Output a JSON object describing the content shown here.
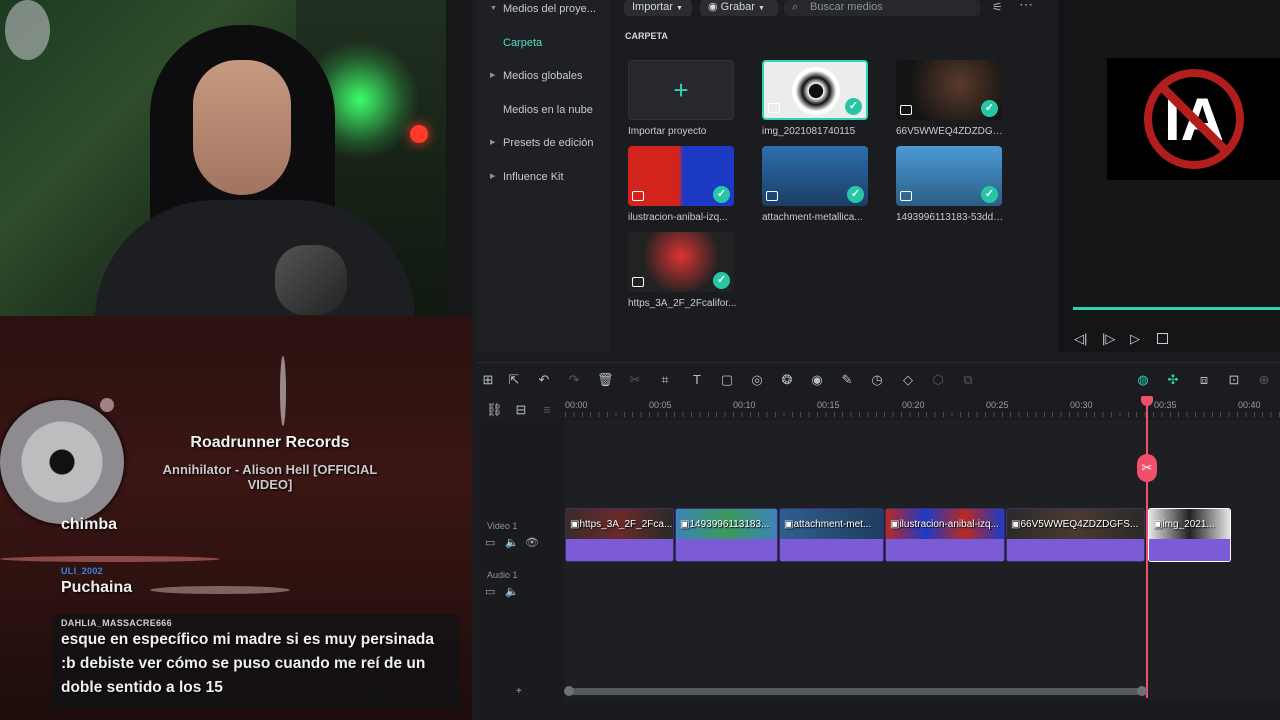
{
  "media_sidebar": {
    "items": [
      {
        "label": "Medios del proye...",
        "expand": true
      },
      {
        "label": "Carpeta",
        "active": true
      },
      {
        "label": "Medios globales",
        "expand": true
      },
      {
        "label": "Medios en la nube"
      },
      {
        "label": "Presets de edición",
        "expand": true
      },
      {
        "label": "Influence Kit",
        "expand": true
      }
    ]
  },
  "media_toolbar": {
    "import_label": "Importar",
    "record_label": "Grabar",
    "search_placeholder": "Buscar medios"
  },
  "media_grid": {
    "folder_label": "CARPETA",
    "import_card_label": "Importar proyecto",
    "items": [
      {
        "name": "img_2021081740115",
        "color": "#e8e8e8",
        "selected": true
      },
      {
        "name": "66V5WWEQ4ZDZDGFS...",
        "color": "#2b2a2a"
      },
      {
        "name": "ilustracion-anibal-izq...",
        "color": "#c8281e"
      },
      {
        "name": "attachment-metallica...",
        "color": "#3a6fa0"
      },
      {
        "name": "1493996113183-53dd4...",
        "color": "#3d84b8"
      },
      {
        "name": "https_3A_2F_2Fcalifor...",
        "color": "#2a2526"
      }
    ]
  },
  "now_playing": {
    "artist": "Roadrunner Records",
    "song": "Annihilator - Alison Hell [OFFICIAL VIDEO]"
  },
  "chat": [
    {
      "user": "",
      "message": "chimba",
      "user_color": "#d24a4a"
    },
    {
      "user": "ULI_2002",
      "message": "Puchaina",
      "user_color": "#3b86e0"
    },
    {
      "user": "DAHLIA_MASSACRE666",
      "message": "esque en específico mi madre si es muy persinada :b debiste ver cómo se puso cuando me reí de un doble sentido a los 15",
      "user_color": "#cfcfcf"
    }
  ],
  "timeline": {
    "ticks": [
      "00:00",
      "00:05",
      "00:10",
      "00:15",
      "00:20",
      "00:25",
      "00:30",
      "00:35",
      "00:40"
    ],
    "tracks": {
      "video": "Video 1",
      "audio": "Audio 1"
    },
    "clips": [
      {
        "title": "https_3A_2F_2Fca...",
        "color": "#3a2a2a"
      },
      {
        "title": "1493996113183...",
        "color": "#3d84b8"
      },
      {
        "title": "attachment-met...",
        "color": "#2f5f8e"
      },
      {
        "title": "ilustracion-anibal-izq...",
        "color": "#b82a22"
      },
      {
        "title": "66V5WWEQ4ZDZDGFS...",
        "color": "#2b2a2a"
      },
      {
        "title": "img_2021...",
        "color": "#e6e6e6"
      }
    ]
  },
  "preview": {
    "logo_text": "IA"
  },
  "colors": {
    "accent": "#2fd3b5",
    "playhead": "#f0506a",
    "clip": "#7c5bd6"
  }
}
